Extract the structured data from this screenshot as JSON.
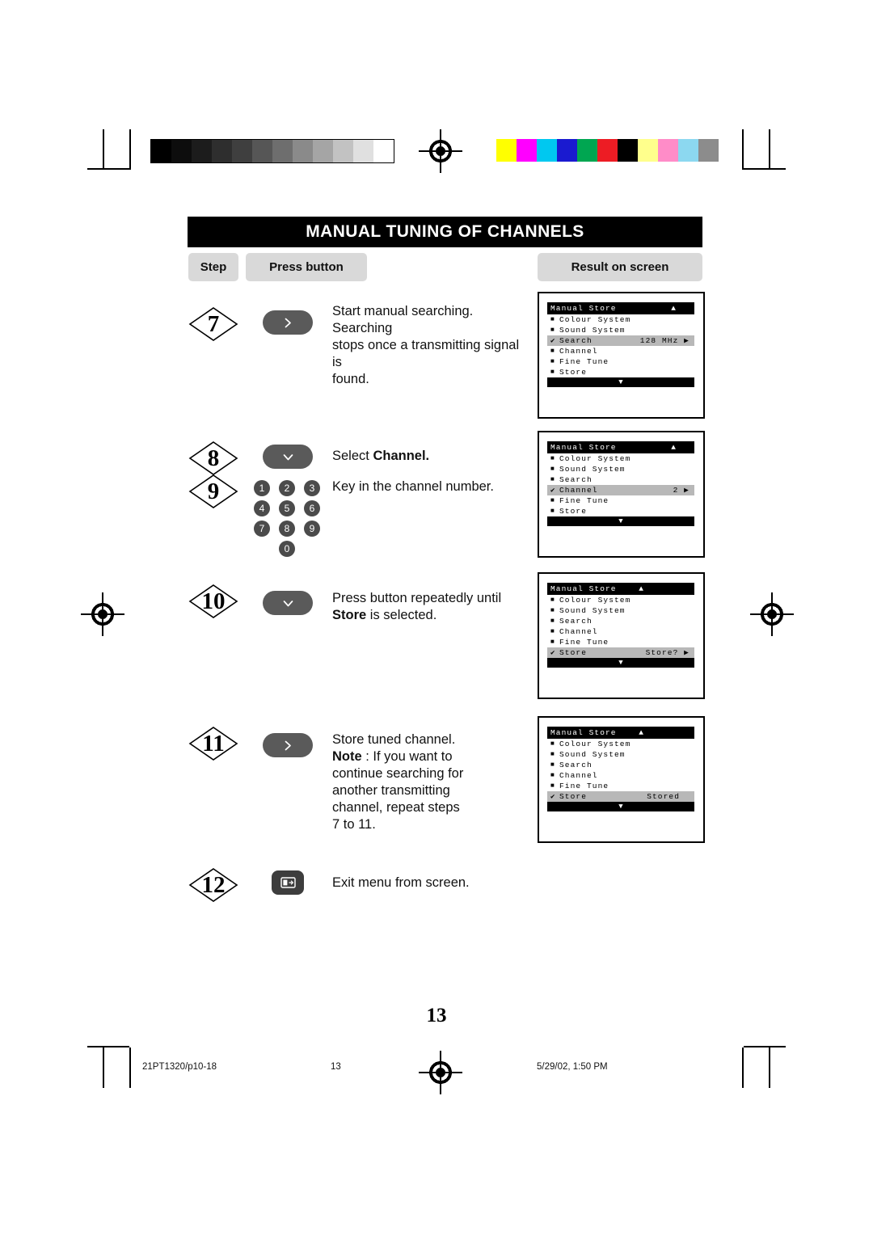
{
  "document": {
    "title": "MANUAL TUNING OF CHANNELS",
    "page_number": "13",
    "footer": {
      "file": "21PT1320/p10-18",
      "page": "13",
      "timestamp": "5/29/02, 1:50 PM"
    }
  },
  "headers": {
    "step": "Step",
    "press_button": "Press button",
    "result": "Result on screen"
  },
  "steps": [
    {
      "number": "7",
      "button": "right-arrow",
      "text_lines": [
        "Start manual searching. Searching",
        "stops once a transmitting signal is",
        "found."
      ]
    },
    {
      "number": "8",
      "button": "down-arrow",
      "text_plain": "Select ",
      "text_bold": "Channel."
    },
    {
      "number": "9",
      "button": "numeric-keypad",
      "text_lines": [
        "Key in the channel number."
      ],
      "keys": [
        [
          "1",
          "2",
          "3"
        ],
        [
          "4",
          "5",
          "6"
        ],
        [
          "7",
          "8",
          "9"
        ],
        [
          "0"
        ]
      ]
    },
    {
      "number": "10",
      "button": "down-arrow",
      "line1": "Press button repeatedly until",
      "line2_bold": "Store",
      "line2_rest": " is selected."
    },
    {
      "number": "11",
      "button": "right-arrow",
      "line1": "Store tuned  channel.",
      "note_bold": "Note",
      "note_rest": " : If you want to",
      "note_lines": [
        "continue searching for",
        "another transmitting",
        "channel, repeat steps",
        "7 to 11."
      ]
    },
    {
      "number": "12",
      "button": "menu-exit",
      "text_lines": [
        "Exit menu from screen."
      ]
    }
  ],
  "osd_screens": [
    {
      "name": "screen-step7",
      "title": "Manual Store",
      "title_arrow": "▲",
      "rows": [
        {
          "marker": "bullet",
          "label": "Colour System",
          "value": "",
          "selected": false
        },
        {
          "marker": "bullet",
          "label": "Sound System",
          "value": "",
          "selected": false
        },
        {
          "marker": "tick",
          "label": "Search",
          "value": "128 MHz ▶",
          "selected": true
        },
        {
          "marker": "bullet",
          "label": "Channel",
          "value": "",
          "selected": false
        },
        {
          "marker": "bullet",
          "label": "Fine Tune",
          "value": "",
          "selected": false
        },
        {
          "marker": "bullet",
          "label": "Store",
          "value": "",
          "selected": false
        }
      ],
      "footer_arrow": "▼",
      "footer_style": "black"
    },
    {
      "name": "screen-step8-9",
      "title": "Manual Store",
      "title_arrow": "▲",
      "rows": [
        {
          "marker": "bullet",
          "label": "Colour System",
          "value": "",
          "selected": false
        },
        {
          "marker": "bullet",
          "label": "Sound System",
          "value": "",
          "selected": false
        },
        {
          "marker": "bullet",
          "label": "Search",
          "value": "",
          "selected": false
        },
        {
          "marker": "tick",
          "label": "Channel",
          "value": "2   ▶",
          "selected": true
        },
        {
          "marker": "bullet",
          "label": "Fine Tune",
          "value": "",
          "selected": false
        },
        {
          "marker": "bullet",
          "label": "Store",
          "value": "",
          "selected": false
        }
      ],
      "footer_arrow": "▼",
      "footer_style": "black"
    },
    {
      "name": "screen-step10",
      "title": "Manual Store",
      "title_arrow": "▲",
      "rows": [
        {
          "marker": "bullet",
          "label": "Colour System",
          "value": "",
          "selected": false
        },
        {
          "marker": "bullet",
          "label": "Sound System",
          "value": "",
          "selected": false
        },
        {
          "marker": "bullet",
          "label": "Search",
          "value": "",
          "selected": false
        },
        {
          "marker": "bullet",
          "label": "Channel",
          "value": "",
          "selected": false
        },
        {
          "marker": "bullet",
          "label": "Fine Tune",
          "value": "",
          "selected": false
        },
        {
          "marker": "tick",
          "label": "Store",
          "value": "Store? ▶",
          "selected": true
        }
      ],
      "footer_arrow": "▼",
      "footer_style": "black"
    },
    {
      "name": "screen-step11",
      "title": "Manual Store",
      "title_arrow": "▲",
      "rows": [
        {
          "marker": "bullet",
          "label": "Colour System",
          "value": "",
          "selected": false
        },
        {
          "marker": "bullet",
          "label": "Sound System",
          "value": "",
          "selected": false
        },
        {
          "marker": "bullet",
          "label": "Search",
          "value": "",
          "selected": false
        },
        {
          "marker": "bullet",
          "label": "Channel",
          "value": "",
          "selected": false
        },
        {
          "marker": "bullet",
          "label": "Fine Tune",
          "value": "",
          "selected": false
        },
        {
          "marker": "tick",
          "label": "Store",
          "value": "Stored",
          "selected": true
        }
      ],
      "footer_arrow": "▼",
      "footer_style": "black"
    }
  ],
  "print_marks": {
    "gray_steps": [
      "#000000",
      "#0d0d0d",
      "#1c1c1c",
      "#2e2e2e",
      "#3f3f3f",
      "#565656",
      "#6e6e6e",
      "#8a8a8a",
      "#a5a5a5",
      "#c2c2c2",
      "#e0e0e0",
      "#ffffff"
    ],
    "color_steps": [
      "#ffff00",
      "#ff00ff",
      "#00c8f0",
      "#1a1ad0",
      "#00a651",
      "#ed1c24",
      "#000000",
      "#ffff8c",
      "#ff8cc8",
      "#8cd8f0",
      "#8c8c8c"
    ]
  }
}
